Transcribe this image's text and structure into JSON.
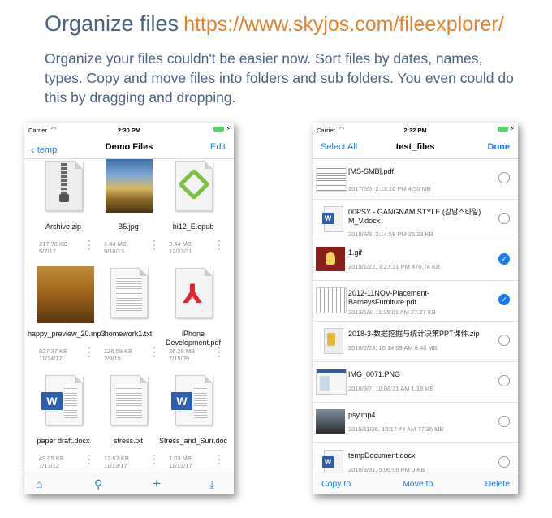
{
  "hero": {
    "title": "Organize files",
    "url": "https://www.skyjos.com/fileexplorer/",
    "description": "Organize your files couldn't be easier now. Sort files by dates, names, types. Copy and move files into folders and sub folders. You even could do this by dragging and dropping."
  },
  "left_phone": {
    "status": {
      "carrier": "Carrier",
      "time": "2:30 PM"
    },
    "nav": {
      "back": "temp",
      "title": "Demo Files",
      "edit": "Edit"
    },
    "files": [
      {
        "name": "Archive.zip",
        "size": "217.78 KB",
        "date": "5/7/12",
        "icon": "zip-icon"
      },
      {
        "name": "B5.jpg",
        "size": "1.44 MB",
        "date": "9/18/13",
        "icon": "landscape-photo-icon"
      },
      {
        "name": "bi12_E.epub",
        "size": "3.44 MB",
        "date": "12/23/11",
        "icon": "epub-icon"
      },
      {
        "name": "happy_preview_20.mp3",
        "size": "827.37 KB",
        "date": "11/14/17",
        "icon": "desert-photo-icon"
      },
      {
        "name": "homework1.txt",
        "size": "126.59 KB",
        "date": "2/9/15",
        "icon": "text-doc-icon"
      },
      {
        "name": "iPhone Development.pdf",
        "size": "26.28 MB",
        "date": "7/15/09",
        "icon": "pdf-icon"
      },
      {
        "name": "paper draft.docx",
        "size": "49.05 KB",
        "date": "7/17/12",
        "icon": "word-doc-icon"
      },
      {
        "name": "stress.txt",
        "size": "12.67 KB",
        "date": "11/13/17",
        "icon": "text-doc-icon"
      },
      {
        "name": "Stress_and_Surr.doc",
        "size": "1.03 MB",
        "date": "11/13/17",
        "icon": "word-doc-icon"
      }
    ],
    "toolbar": [
      "home-icon",
      "search-icon",
      "add-icon",
      "download-icon"
    ]
  },
  "right_phone": {
    "status": {
      "carrier": "Carrier",
      "time": "2:32 PM"
    },
    "nav": {
      "select_all": "Select All",
      "title": "test_files",
      "done": "Done"
    },
    "rows": [
      {
        "name": "[MS-SMB].pdf",
        "meta": "2017/5/5, 2:18:20 PM   4.50 MB",
        "checked": false,
        "icon": "pdf-page-icon"
      },
      {
        "name": "00PSY - GANGNAM STYLE (강남스타일) M_V.docx",
        "meta": "2018/9/3, 2:14:58 PM   25.23 KB",
        "checked": false,
        "icon": "word-doc-icon"
      },
      {
        "name": "1.gif",
        "meta": "2015/1/22, 3:27:21 PM   470.74 KB",
        "checked": true,
        "icon": "gif-image-icon"
      },
      {
        "name": "2012-11NOV-Placement-BarneysFurniture.pdf",
        "meta": "2013/1/8, 11:25:01 AM   27.27 KB",
        "checked": true,
        "icon": "spreadsheet-pdf-icon"
      },
      {
        "name": "2018-3-数据挖掘与统计决策PPT课件.zip",
        "meta": "2018/2/28, 10:14:09 AM   8.46 MB",
        "checked": false,
        "icon": "zip-icon"
      },
      {
        "name": "IMG_0071.PNG",
        "meta": "2018/9/7, 10:08:21 AM   1.18 MB",
        "checked": false,
        "icon": "screenshot-icon"
      },
      {
        "name": "psy.mp4",
        "meta": "2015/11/26, 10:17:44 AM   77.36 MB",
        "checked": false,
        "icon": "video-thumbnail-icon"
      },
      {
        "name": "tempDocument.docx",
        "meta": "2018/8/31, 5:06:06 PM   0 KB",
        "checked": false,
        "icon": "word-doc-icon"
      }
    ],
    "toolbar": {
      "copy": "Copy to",
      "move": "Move to",
      "delete": "Delete"
    }
  }
}
